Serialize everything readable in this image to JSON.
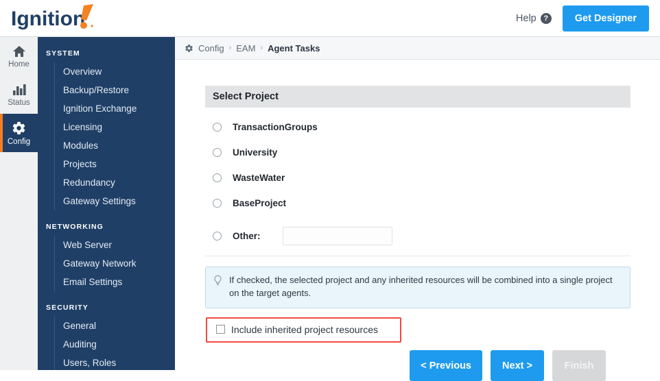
{
  "header": {
    "logo_text": "Ignition",
    "help_label": "Help",
    "help_icon": "question-circle-icon",
    "get_designer_label": "Get Designer",
    "accent_blue": "#1e9bef"
  },
  "rail": {
    "items": [
      {
        "label": "Home",
        "icon": "home-icon",
        "active": false
      },
      {
        "label": "Status",
        "icon": "bar-chart-icon",
        "active": false
      },
      {
        "label": "Config",
        "icon": "gear-icon",
        "active": true
      }
    ],
    "active_color": "#1f3f66",
    "active_marker_color": "#f57c20"
  },
  "sidebar": {
    "background": "#1f3f66",
    "sections": [
      {
        "title": "SYSTEM",
        "items": [
          {
            "label": "Overview"
          },
          {
            "label": "Backup/Restore"
          },
          {
            "label": "Ignition Exchange"
          },
          {
            "label": "Licensing"
          },
          {
            "label": "Modules"
          },
          {
            "label": "Projects"
          },
          {
            "label": "Redundancy"
          },
          {
            "label": "Gateway Settings"
          }
        ]
      },
      {
        "title": "NETWORKING",
        "items": [
          {
            "label": "Web Server"
          },
          {
            "label": "Gateway Network"
          },
          {
            "label": "Email Settings"
          }
        ]
      },
      {
        "title": "SECURITY",
        "items": [
          {
            "label": "General"
          },
          {
            "label": "Auditing"
          },
          {
            "label": "Users, Roles"
          }
        ]
      }
    ]
  },
  "breadcrumb": {
    "icon": "gear-icon",
    "items": [
      {
        "label": "Config",
        "current": false
      },
      {
        "label": "EAM",
        "current": false
      },
      {
        "label": "Agent Tasks",
        "current": true
      }
    ],
    "separator": "›"
  },
  "main": {
    "panel_title": "Select Project",
    "projects": [
      {
        "label": "TransactionGroups",
        "selected": false
      },
      {
        "label": "University",
        "selected": false
      },
      {
        "label": "WasteWater",
        "selected": false
      },
      {
        "label": "BaseProject",
        "selected": false
      }
    ],
    "other": {
      "label": "Other:",
      "selected": false,
      "value": "",
      "placeholder": ""
    },
    "info": {
      "icon": "lightbulb-icon",
      "text": "If checked, the selected project and any inherited resources will be combined into a single project on the target agents."
    },
    "checkbox": {
      "label": "Include inherited project resources",
      "checked": false,
      "highlight_color": "#f04a3f"
    },
    "buttons": [
      {
        "label": "< Previous",
        "state": "enabled"
      },
      {
        "label": "Next >",
        "state": "enabled"
      },
      {
        "label": "Finish",
        "state": "disabled"
      }
    ]
  }
}
